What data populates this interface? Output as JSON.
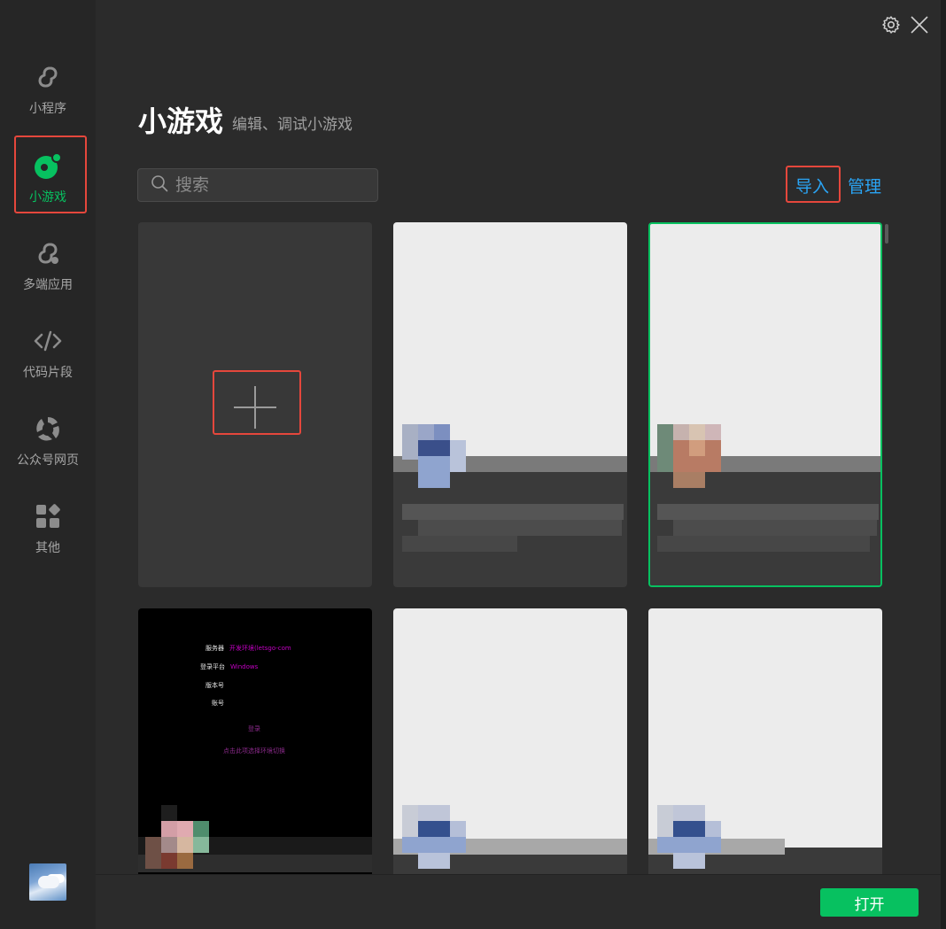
{
  "sidebar": {
    "items": [
      {
        "label": "小程序",
        "icon": "mini-program-icon",
        "active": false
      },
      {
        "label": "小游戏",
        "icon": "mini-game-icon",
        "active": true
      },
      {
        "label": "多端应用",
        "icon": "multi-platform-icon",
        "active": false
      },
      {
        "label": "代码片段",
        "icon": "code-snippet-icon",
        "active": false
      },
      {
        "label": "公众号网页",
        "icon": "official-account-icon",
        "active": false
      },
      {
        "label": "其他",
        "icon": "other-apps-icon",
        "active": false
      }
    ]
  },
  "header": {
    "title": "小游戏",
    "subtitle": "编辑、调试小游戏"
  },
  "search": {
    "placeholder": "搜索",
    "value": ""
  },
  "actions": {
    "import_label": "导入",
    "manage_label": "管理"
  },
  "login_card": {
    "rows": [
      {
        "key": "服务器",
        "value": "开发环境(letsgo-com"
      },
      {
        "key": "登录平台",
        "value": "Windows"
      },
      {
        "key": "版本号",
        "value": ""
      },
      {
        "key": "账号",
        "value": ""
      }
    ],
    "login_text": "登录",
    "hint_text": "点击此项选择环境切换"
  },
  "footer": {
    "open_label": "打开"
  },
  "colors": {
    "accent": "#07c160",
    "link": "#2aa4f4",
    "highlight": "#e5473c"
  }
}
